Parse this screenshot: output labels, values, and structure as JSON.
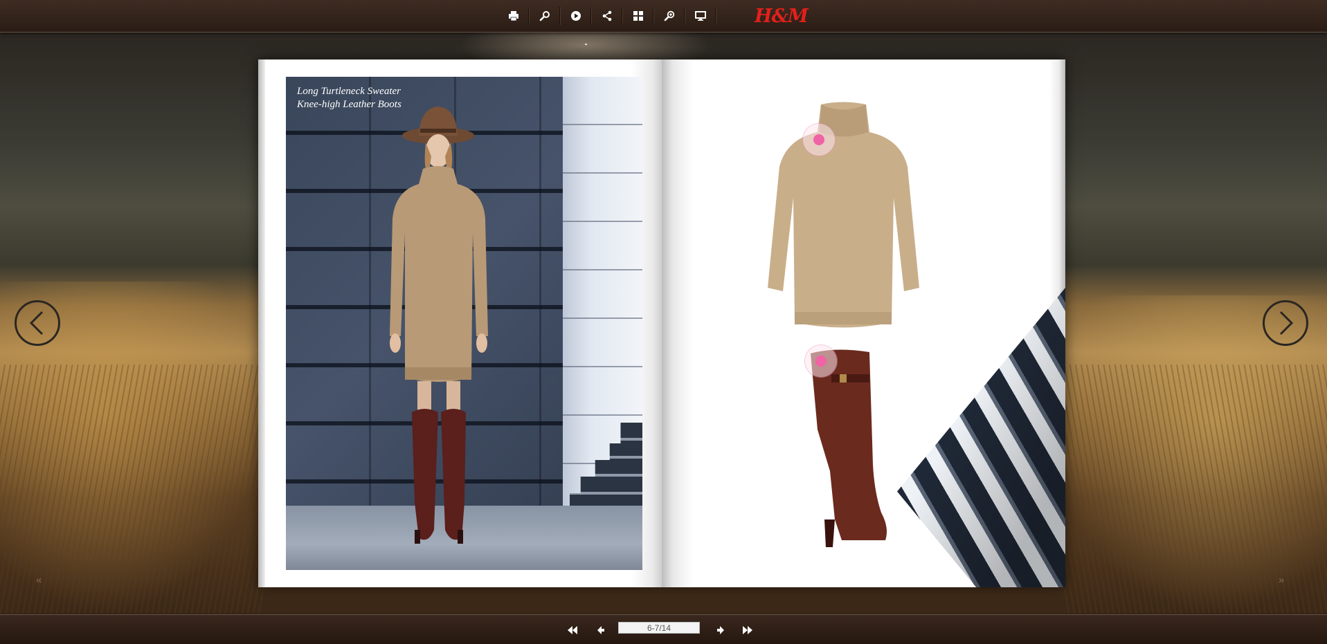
{
  "toolbar": {
    "buttons": [
      {
        "name": "print-button",
        "icon": "print-icon"
      },
      {
        "name": "search-button",
        "icon": "search-icon"
      },
      {
        "name": "autoplay-button",
        "icon": "play-icon"
      },
      {
        "name": "share-button",
        "icon": "share-icon"
      },
      {
        "name": "thumbnails-button",
        "icon": "grid-icon"
      },
      {
        "name": "zoom-button",
        "icon": "zoom-icon"
      },
      {
        "name": "fullscreen-button",
        "icon": "monitor-icon"
      }
    ],
    "logo_text": "H&M",
    "logo_color": "#e3201b"
  },
  "book": {
    "left_page": {
      "caption_line1": "Long Turtleneck Sweater",
      "caption_line2": "Knee-high Leather Boots"
    },
    "right_page": {
      "hotspots": [
        "sweater-hotspot",
        "boot-hotspot"
      ],
      "hotspot_color": "#f063a6"
    }
  },
  "navigation": {
    "first_icon": "double-left-arrow-icon",
    "prev_icon": "left-arrow-icon",
    "page_indicator": "6-7/14",
    "next_icon": "right-arrow-icon",
    "last_icon": "double-right-arrow-icon"
  },
  "side_nav": {
    "prev_icon": "chevron-left-icon",
    "next_icon": "chevron-right-icon"
  }
}
